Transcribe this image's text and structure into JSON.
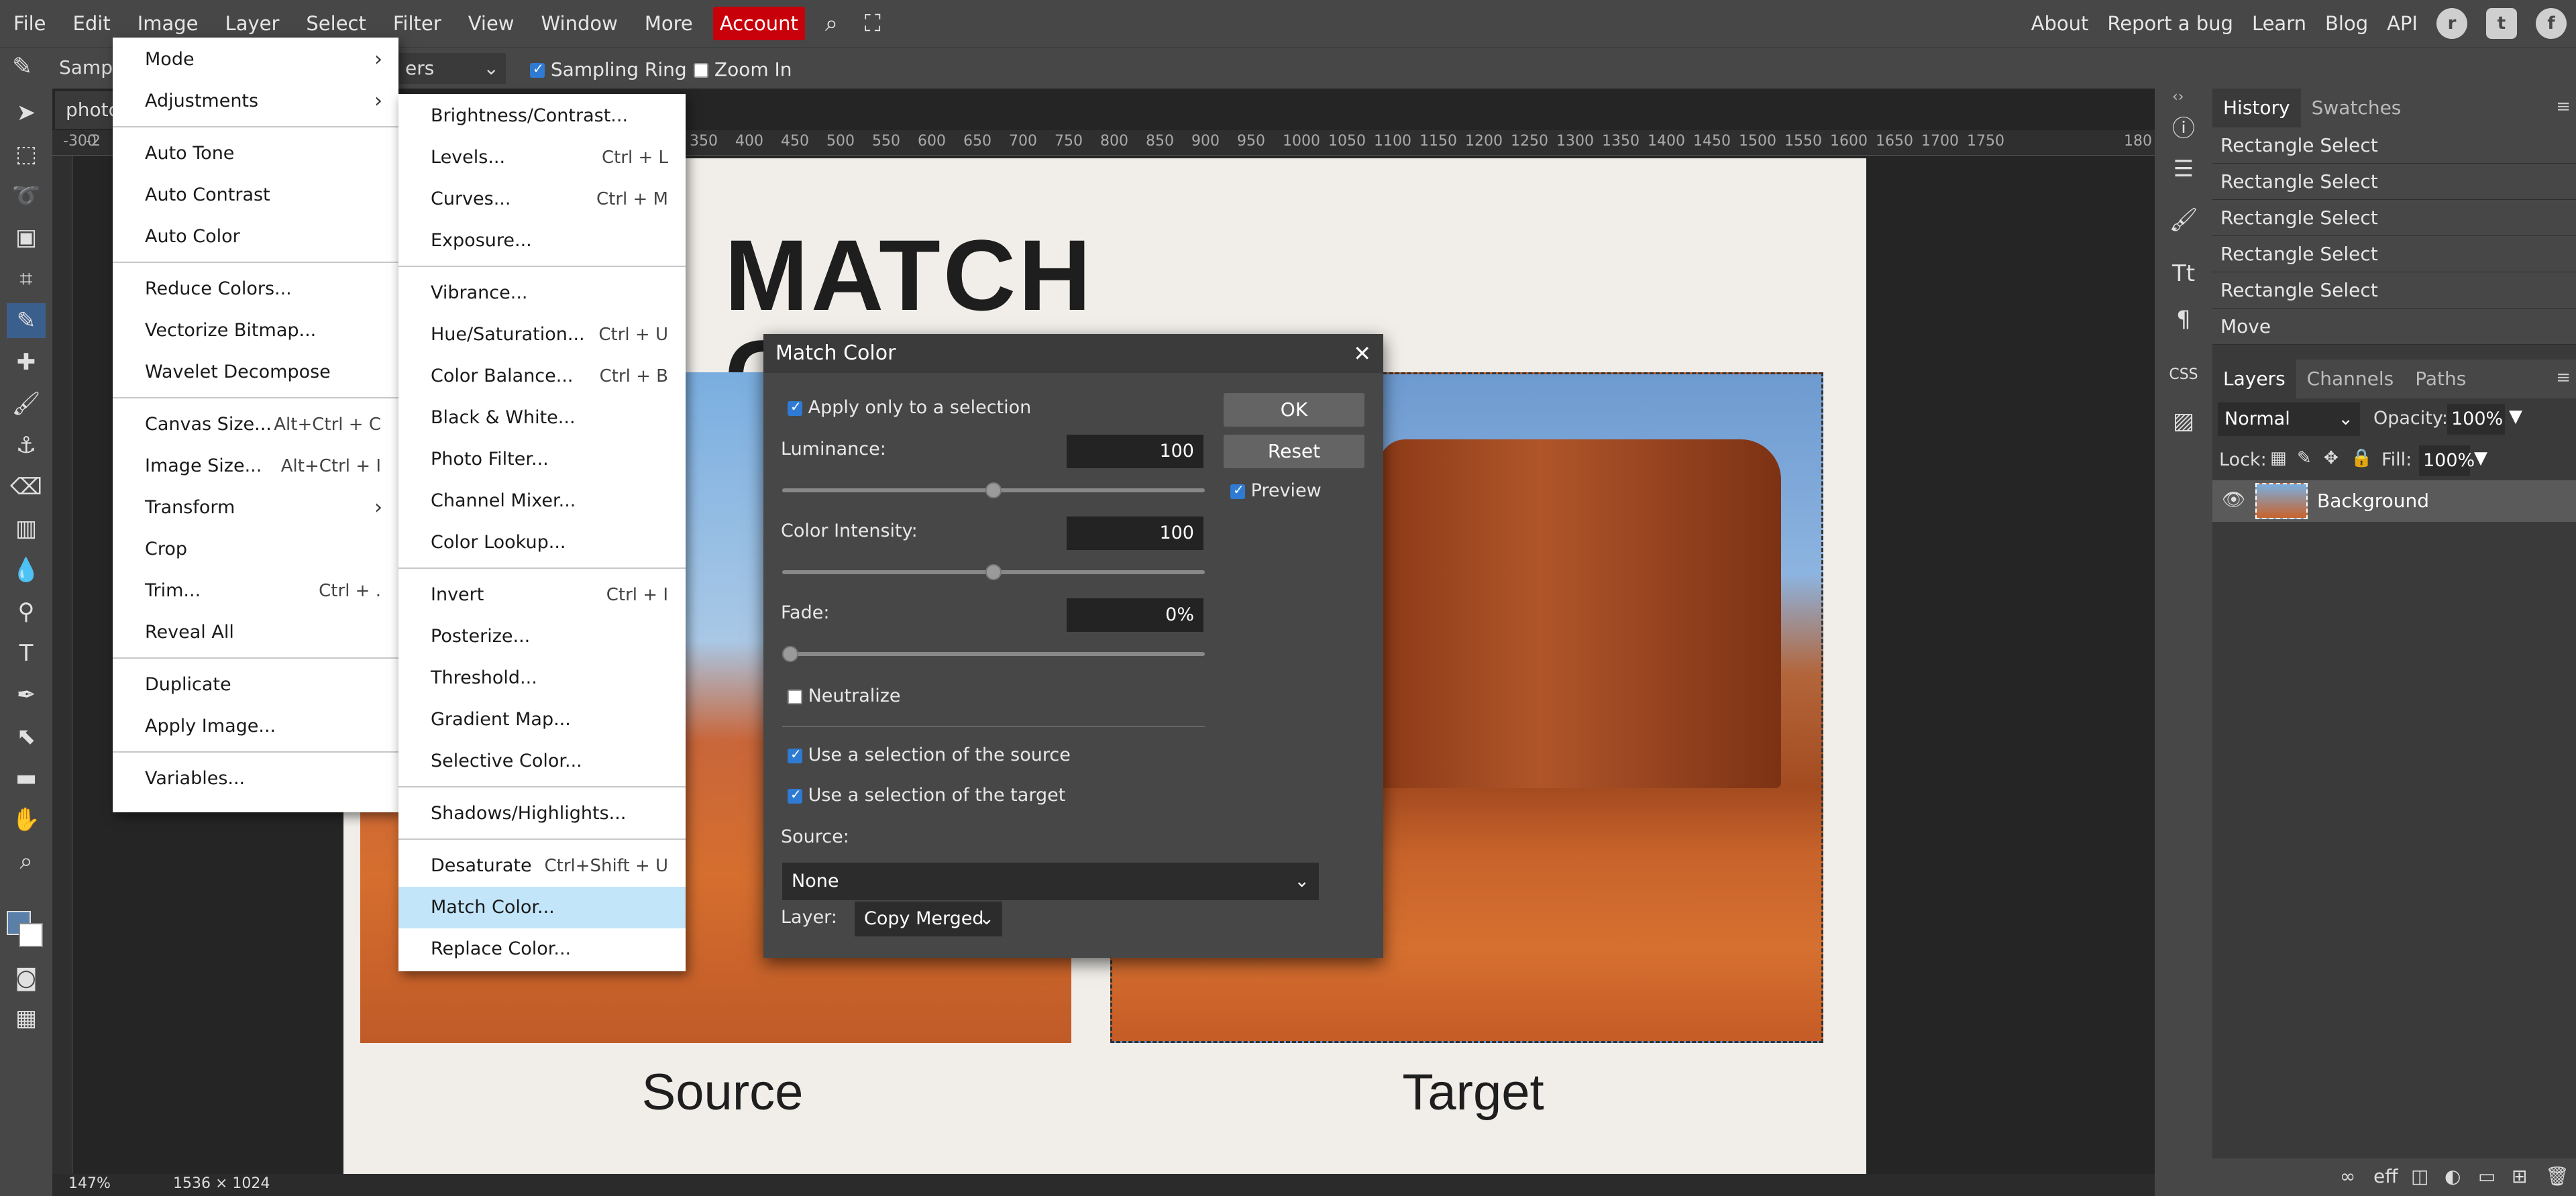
{
  "menubar": {
    "items": [
      "File",
      "Edit",
      "Image",
      "Layer",
      "Select",
      "Filter",
      "View",
      "Window",
      "More"
    ],
    "account": "Account",
    "right_links": [
      "About",
      "Report a bug",
      "Learn",
      "Blog",
      "API"
    ],
    "right_icons": [
      "reddit-icon",
      "twitter-icon",
      "facebook-icon"
    ]
  },
  "options": {
    "sample_label": "Sampl",
    "select_value": "ers",
    "sampling_ring": "Sampling Ring",
    "zoom_in": "Zoom In"
  },
  "document": {
    "tab": "photo",
    "title": "MATCH COLOR",
    "source_label": "Source",
    "target_label": "Target"
  },
  "ruler": {
    "ticks": [
      "-300",
      "-2",
      "350",
      "400",
      "450",
      "500",
      "550",
      "600",
      "650",
      "700",
      "750",
      "800",
      "850",
      "900",
      "950",
      "1000",
      "1050",
      "1100",
      "1150",
      "1200",
      "1250",
      "1300",
      "1350",
      "1400",
      "1450",
      "1500",
      "1550",
      "1600",
      "1650",
      "1700",
      "1750",
      "180"
    ]
  },
  "status": {
    "zoom": "147%",
    "size": "1536 × 1024"
  },
  "image_menu": {
    "groups": [
      [
        {
          "label": "Mode",
          "arrow": "›"
        },
        {
          "label": "Adjustments",
          "arrow": "›"
        }
      ],
      [
        {
          "label": "Auto Tone"
        },
        {
          "label": "Auto Contrast"
        },
        {
          "label": "Auto Color"
        }
      ],
      [
        {
          "label": "Reduce Colors..."
        },
        {
          "label": "Vectorize Bitmap..."
        },
        {
          "label": "Wavelet Decompose"
        }
      ],
      [
        {
          "label": "Canvas Size...",
          "sc": "Alt+Ctrl + C"
        },
        {
          "label": "Image Size...",
          "sc": "Alt+Ctrl + I"
        },
        {
          "label": "Transform",
          "arrow": "›"
        },
        {
          "label": "Crop"
        },
        {
          "label": "Trim...",
          "sc": "Ctrl + ."
        },
        {
          "label": "Reveal All"
        }
      ],
      [
        {
          "label": "Duplicate"
        },
        {
          "label": "Apply Image..."
        }
      ],
      [
        {
          "label": "Variables..."
        }
      ]
    ]
  },
  "adjust_menu": {
    "groups": [
      [
        {
          "label": "Brightness/Contrast..."
        },
        {
          "label": "Levels...",
          "sc": "Ctrl + L"
        },
        {
          "label": "Curves...",
          "sc": "Ctrl + M"
        },
        {
          "label": "Exposure..."
        }
      ],
      [
        {
          "label": "Vibrance..."
        },
        {
          "label": "Hue/Saturation...",
          "sc": "Ctrl + U"
        },
        {
          "label": "Color Balance...",
          "sc": "Ctrl + B"
        },
        {
          "label": "Black & White..."
        },
        {
          "label": "Photo Filter..."
        },
        {
          "label": "Channel Mixer..."
        },
        {
          "label": "Color Lookup..."
        }
      ],
      [
        {
          "label": "Invert",
          "sc": "Ctrl + I"
        },
        {
          "label": "Posterize..."
        },
        {
          "label": "Threshold..."
        },
        {
          "label": "Gradient Map..."
        },
        {
          "label": "Selective Color..."
        }
      ],
      [
        {
          "label": "Shadows/Highlights..."
        }
      ],
      [
        {
          "label": "Desaturate",
          "sc": "Ctrl+Shift + U"
        },
        {
          "label": "Match Color...",
          "highlighted": true
        },
        {
          "label": "Replace Color..."
        }
      ]
    ]
  },
  "dialog": {
    "title": "Match Color",
    "apply_selection": "Apply only to a selection",
    "ok": "OK",
    "reset": "Reset",
    "preview": "Preview",
    "luminance_label": "Luminance:",
    "luminance_value": "100",
    "luminance_fraction": 0.5,
    "intensity_label": "Color Intensity:",
    "intensity_value": "100",
    "intensity_fraction": 0.5,
    "fade_label": "Fade:",
    "fade_value": "0%",
    "fade_fraction": 0.0,
    "neutralize": "Neutralize",
    "use_source_sel": "Use a selection of the source",
    "use_target_sel": "Use a selection of the target",
    "source_label": "Source:",
    "source_value": "None",
    "layer_label": "Layer:",
    "layer_value": "Copy Merged"
  },
  "history": {
    "tabs": [
      "History",
      "Swatches"
    ],
    "items": [
      "Rectangle Select",
      "Rectangle Select",
      "Rectangle Select",
      "Rectangle Select",
      "Rectangle Select",
      "Move"
    ]
  },
  "layers": {
    "tabs": [
      "Layers",
      "Channels",
      "Paths"
    ],
    "blend": "Normal",
    "opacity_label": "Opacity:",
    "opacity": "100%",
    "lock_label": "Lock:",
    "fill_label": "Fill:",
    "fill": "100%",
    "layer_name": "Background",
    "bottom_icons": [
      "link-icon",
      "effects-icon",
      "mask-icon",
      "adjustment-icon",
      "folder-icon",
      "new-layer-icon",
      "trash-icon"
    ],
    "effects_text": "eff"
  },
  "colors": {
    "accent": "#2f7bd3",
    "account": "#c8000a",
    "highlight": "#c2e5f9"
  }
}
